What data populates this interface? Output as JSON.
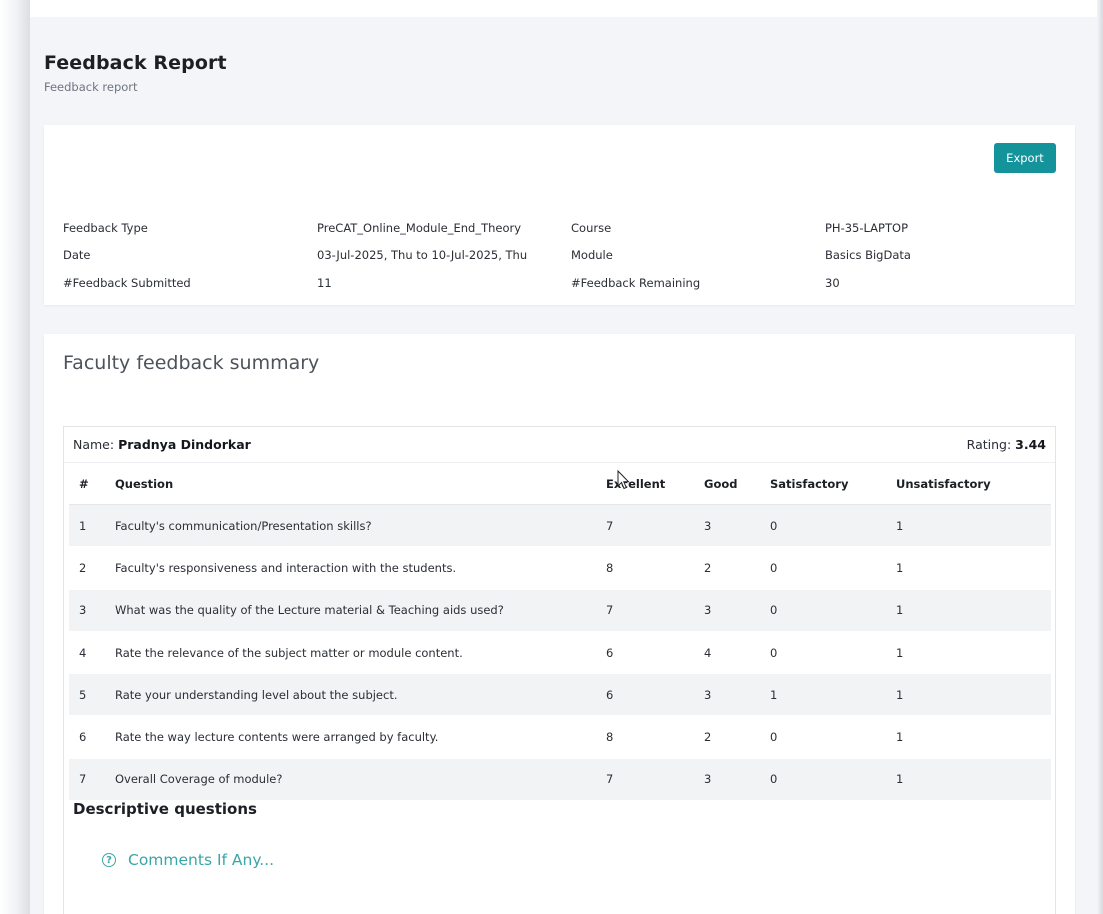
{
  "header": {
    "title": "Feedback Report",
    "subtitle": "Feedback report"
  },
  "info_card": {
    "export_label": "Export",
    "rows": [
      {
        "label1": "Feedback Type",
        "value1": "PreCAT_Online_Module_End_Theory",
        "label2": "Course",
        "value2": "PH-35-LAPTOP"
      },
      {
        "label1": "Date",
        "value1": "03-Jul-2025, Thu to 10-Jul-2025, Thu",
        "label2": "Module",
        "value2": "Basics BigData"
      },
      {
        "label1": "#Feedback Submitted",
        "value1": "11",
        "label2": "#Feedback Remaining",
        "value2": "30"
      }
    ]
  },
  "summary": {
    "title": "Faculty feedback summary",
    "name_label": "Name:",
    "name": "Pradnya Dindorkar",
    "rating_label": "Rating:",
    "rating": "3.44",
    "columns": [
      "#",
      "Question",
      "Excellent",
      "Good",
      "Satisfactory",
      "Unsatisfactory"
    ],
    "rows": [
      {
        "num": "1",
        "question": "Faculty's communication/Presentation skills?",
        "excellent": "7",
        "good": "3",
        "satisfactory": "0",
        "unsatisfactory": "1"
      },
      {
        "num": "2",
        "question": "Faculty's responsiveness and interaction with the students.",
        "excellent": "8",
        "good": "2",
        "satisfactory": "0",
        "unsatisfactory": "1"
      },
      {
        "num": "3",
        "question": "What was the quality of the Lecture material & Teaching aids used?",
        "excellent": "7",
        "good": "3",
        "satisfactory": "0",
        "unsatisfactory": "1"
      },
      {
        "num": "4",
        "question": "Rate the relevance of the subject matter or module content.",
        "excellent": "6",
        "good": "4",
        "satisfactory": "0",
        "unsatisfactory": "1"
      },
      {
        "num": "5",
        "question": "Rate your understanding level about the subject.",
        "excellent": "6",
        "good": "3",
        "satisfactory": "1",
        "unsatisfactory": "1"
      },
      {
        "num": "6",
        "question": "Rate the way lecture contents were arranged by faculty.",
        "excellent": "8",
        "good": "2",
        "satisfactory": "0",
        "unsatisfactory": "1"
      },
      {
        "num": "7",
        "question": "Overall Coverage of module?",
        "excellent": "7",
        "good": "3",
        "satisfactory": "0",
        "unsatisfactory": "1"
      }
    ],
    "descriptive_title": "Descriptive questions",
    "comment_label": "Comments If Any...",
    "comment_icon": "question-circle-icon"
  },
  "colors": {
    "accent": "#14939a",
    "link": "#3aa6a6",
    "page_bg": "#f4f5f8",
    "stripe": "#f2f3f5"
  }
}
